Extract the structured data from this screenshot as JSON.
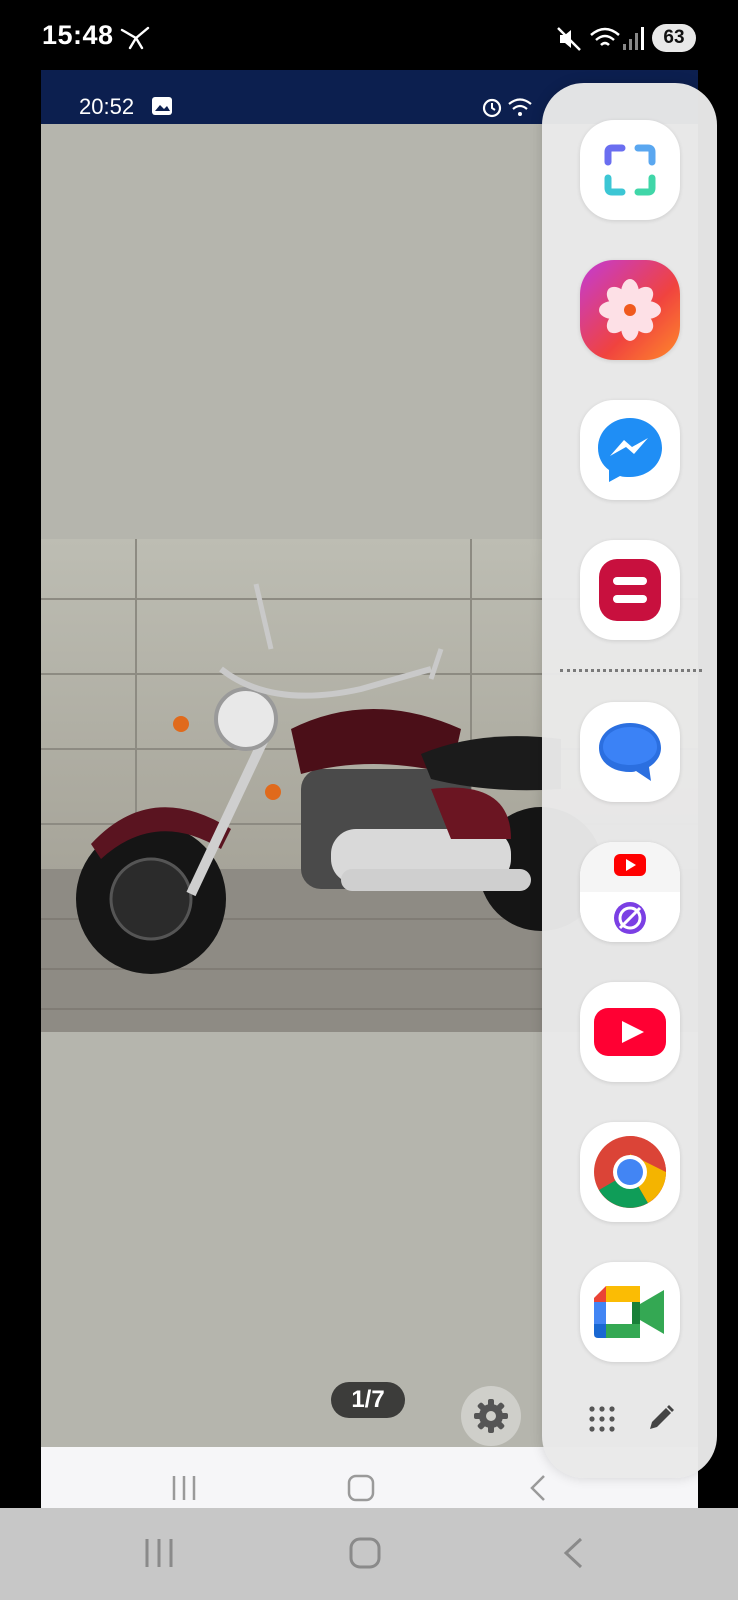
{
  "status_bar": {
    "time": "15:48",
    "battery": "63"
  },
  "inner_screen": {
    "status_time": "20:52",
    "page_indicator": "1/7",
    "photo_description_icon": "motorcycle-photo"
  },
  "edge_panel": {
    "apps": [
      {
        "name": "screenshot-app",
        "icon": "scan-frame-icon"
      },
      {
        "name": "gallery-app",
        "icon": "flower-icon"
      },
      {
        "name": "messenger-app",
        "icon": "messenger-bolt-icon"
      },
      {
        "name": "red-app",
        "icon": "equal-bars-icon"
      },
      {
        "name": "messages-app",
        "icon": "chat-bubble-icon"
      },
      {
        "name": "app-pair",
        "icon": "youtube-internet-pair-icon"
      },
      {
        "name": "youtube-app",
        "icon": "youtube-play-icon"
      },
      {
        "name": "chrome-app",
        "icon": "chrome-icon"
      },
      {
        "name": "meet-app",
        "icon": "meet-camera-icon"
      }
    ],
    "footer_icons": [
      "grid-dots-icon",
      "edit-pencil-icon"
    ]
  },
  "colors": {
    "inner_status_bg": "#0c1f4f",
    "photo_bg": "#b5b5ad",
    "panel_bg": "#e9e9e9"
  }
}
